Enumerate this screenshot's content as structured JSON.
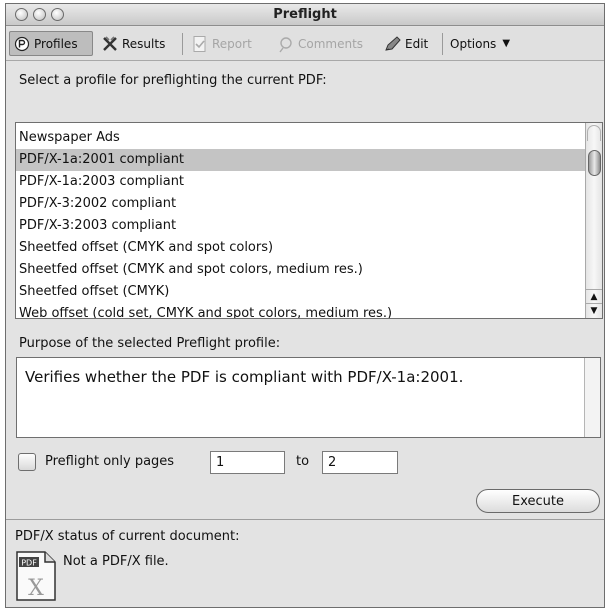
{
  "window": {
    "title": "Preflight"
  },
  "toolbar": {
    "profiles": "Profiles",
    "results": "Results",
    "report": "Report",
    "comments": "Comments",
    "edit": "Edit",
    "options": "Options"
  },
  "instruction": "Select a profile for preflighting the current PDF:",
  "profiles": {
    "items": [
      {
        "label": "Newspaper Ads"
      },
      {
        "label": "PDF/X-1a:2001 compliant"
      },
      {
        "label": "PDF/X-1a:2003 compliant"
      },
      {
        "label": "PDF/X-3:2002 compliant"
      },
      {
        "label": "PDF/X-3:2003 compliant"
      },
      {
        "label": "Sheetfed offset (CMYK and spot colors)"
      },
      {
        "label": "Sheetfed offset (CMYK and spot colors, medium res.)"
      },
      {
        "label": "Sheetfed offset (CMYK)"
      },
      {
        "label": "Web offset (cold set, CMYK and spot colors, medium res.)"
      }
    ],
    "selected_index": 1
  },
  "purpose": {
    "label": "Purpose of the selected Preflight profile:",
    "text": "Verifies whether the PDF is compliant with PDF/X-1a:2001."
  },
  "pages": {
    "label": "Preflight only pages",
    "from": "1",
    "to_label": "to",
    "to": "2"
  },
  "execute": "Execute",
  "status": {
    "label": "PDF/X status of current document:",
    "text": "Not a PDF/X file.",
    "icon_text": "PDF"
  },
  "colors": {
    "selected_row": "#c4c4c4",
    "window_bg": "#e3e3e3"
  }
}
